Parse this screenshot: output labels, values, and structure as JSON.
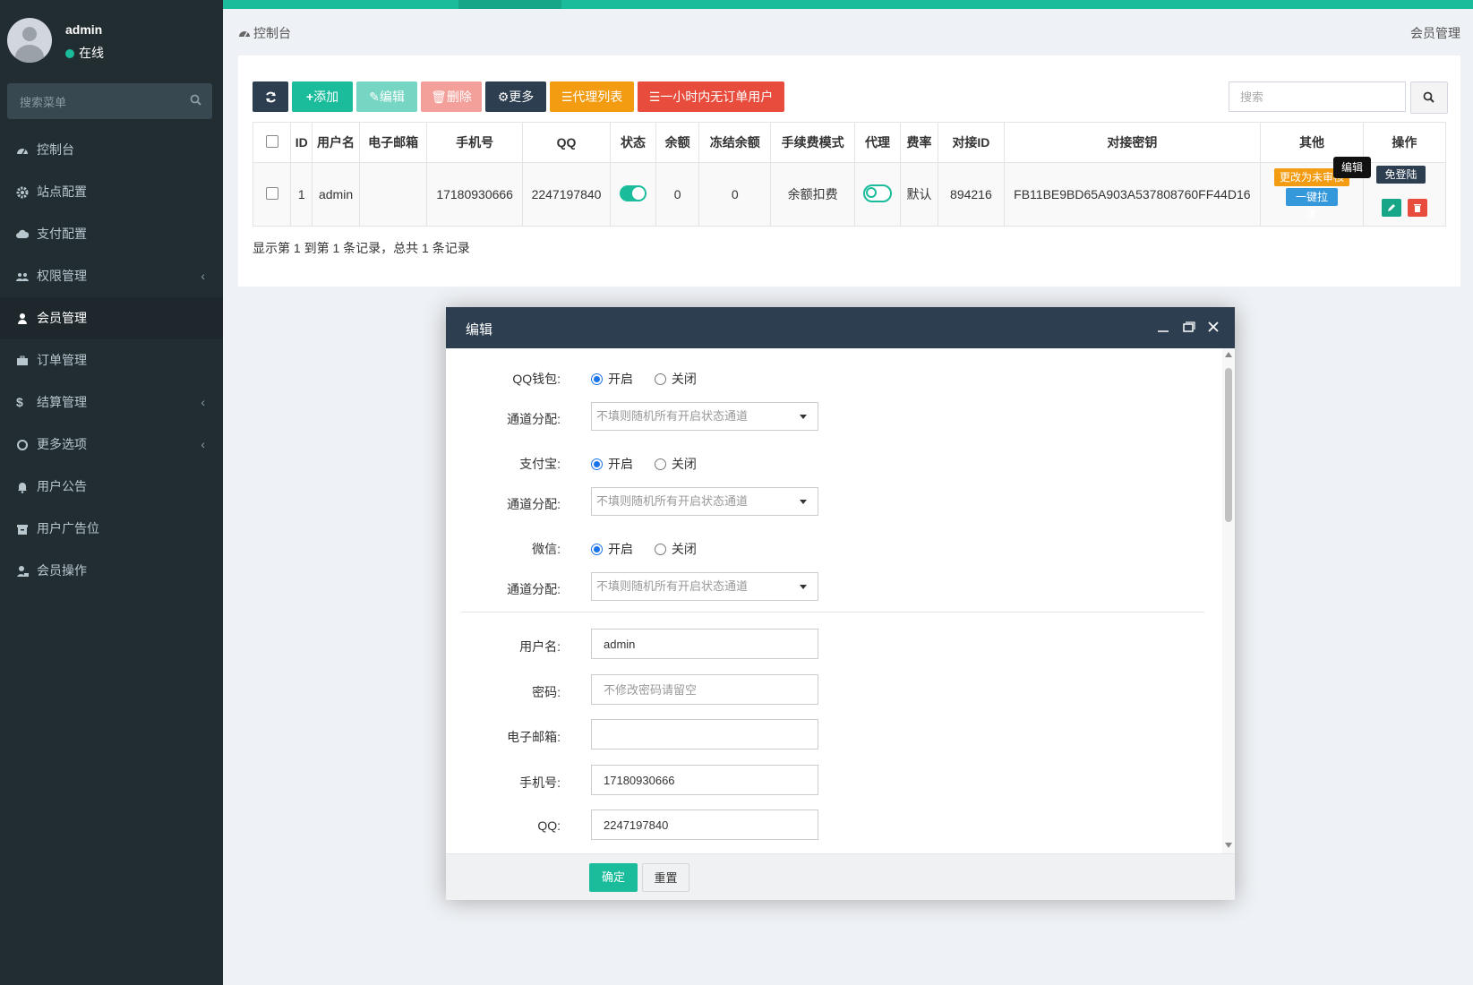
{
  "colors": {
    "brand": "#1abc9c",
    "sidebar": "#222d32",
    "modal_header": "#2c3e50"
  },
  "user": {
    "name": "admin",
    "status": "在线"
  },
  "side_search": {
    "placeholder": "搜索菜单"
  },
  "menu": [
    {
      "label": "控制台",
      "icon": "dashboard-icon"
    },
    {
      "label": "站点配置",
      "icon": "gear-icon"
    },
    {
      "label": "支付配置",
      "icon": "cloud-icon"
    },
    {
      "label": "权限管理",
      "icon": "users-icon"
    },
    {
      "label": "会员管理",
      "icon": "user-icon"
    },
    {
      "label": "订单管理",
      "icon": "briefcase-icon"
    },
    {
      "label": "结算管理",
      "icon": "dollar-icon"
    },
    {
      "label": "更多选项",
      "icon": "circle-icon"
    },
    {
      "label": "用户公告",
      "icon": "bell-icon"
    },
    {
      "label": "用户广告位",
      "icon": "archive-icon"
    },
    {
      "label": "会员操作",
      "icon": "user-lock-icon"
    }
  ],
  "breadcrumb": {
    "left": "控制台",
    "right": "会员管理"
  },
  "toolbar": {
    "add": "添加",
    "edit": "编辑",
    "delete": "删除",
    "more": "更多",
    "agent_list": "代理列表",
    "no_order": "一小时内无订单用户"
  },
  "search": {
    "placeholder": "搜索"
  },
  "table": {
    "headers": [
      "ID",
      "用户名",
      "电子邮箱",
      "手机号",
      "QQ",
      "状态",
      "余额",
      "冻结余额",
      "手续费模式",
      "代理",
      "费率",
      "对接ID",
      "对接密钥",
      "其他",
      "操作"
    ],
    "row": {
      "id": "1",
      "username": "admin",
      "email": "",
      "phone": "17180930666",
      "qq": "2247197840",
      "balance": "0",
      "frozen": "0",
      "fee_mode": "余额扣费",
      "rate": "默认",
      "dock_id": "894216",
      "dock_key": "FB11BE9BD65A903A537808760FF44D16",
      "tag_review": "更改为未审核",
      "tag_black": "一键拉黑"
    },
    "tooltip": "编辑",
    "tooltip_under": "免登陆",
    "footer": "显示第 1 到第 1 条记录，总共 1 条记录"
  },
  "modal": {
    "title": "编辑",
    "fields": {
      "qq_wallet": "QQ钱包:",
      "channel": "通道分配:",
      "alipay": "支付宝:",
      "wechat": "微信:",
      "open": "开启",
      "close": "关闭",
      "channel_placeholder": "不填则随机所有开启状态通道",
      "username_label": "用户名:",
      "username_value": "admin",
      "password_label": "密码:",
      "password_placeholder": "不修改密码请留空",
      "email_label": "电子邮箱:",
      "email_value": "",
      "phone_label": "手机号:",
      "phone_value": "17180930666",
      "qq_label": "QQ:",
      "qq_value": "2247197840"
    },
    "confirm": "确定",
    "reset": "重置"
  }
}
